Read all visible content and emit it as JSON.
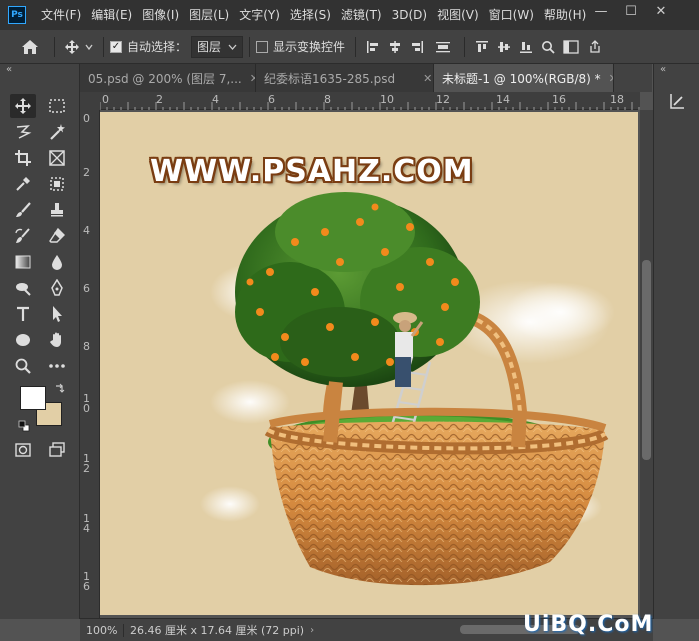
{
  "app": {
    "logo": "Ps"
  },
  "menu": {
    "items": [
      "文件(F)",
      "编辑(E)",
      "图像(I)",
      "图层(L)",
      "文字(Y)",
      "选择(S)",
      "滤镜(T)",
      "3D(D)",
      "视图(V)",
      "窗口(W)",
      "帮助(H)"
    ]
  },
  "window_controls": {
    "minimize": "—",
    "maximize": "☐",
    "close": "✕"
  },
  "options": {
    "auto_select_label": "自动选择：",
    "auto_select_checked": true,
    "layer_dropdown": "图层",
    "show_transform_label": "显示变换控件",
    "show_transform_checked": false
  },
  "panel_collapse": "«",
  "tabs": [
    {
      "label": "05.psd @ 200% (图层 7,...",
      "close": "✕",
      "active": false
    },
    {
      "label": "纪委标语1635-285.psd",
      "close": "✕",
      "active": false
    },
    {
      "label": "未标题-1 @ 100%(RGB/8) *",
      "close": "✕",
      "active": true
    }
  ],
  "ruler": {
    "h_labels": [
      "0",
      "2",
      "4",
      "6",
      "8",
      "10",
      "12",
      "14",
      "16",
      "18"
    ],
    "v_labels": [
      "0",
      "2",
      "4",
      "6",
      "8",
      "1\n0",
      "1\n2",
      "1\n4",
      "1\n6"
    ]
  },
  "canvas": {
    "watermark": "WWW.PSAHZ.COM",
    "background": "#e2cfa6"
  },
  "colors": {
    "foreground": "#ffffff",
    "background": "#e2cfa6",
    "accent": "#31a8ff"
  },
  "status": {
    "zoom": "100%",
    "doc_info": "26.46 厘米 x 17.64 厘米 (72 ppi)",
    "arrow": "›"
  },
  "brand": "UiBQ.CoM"
}
